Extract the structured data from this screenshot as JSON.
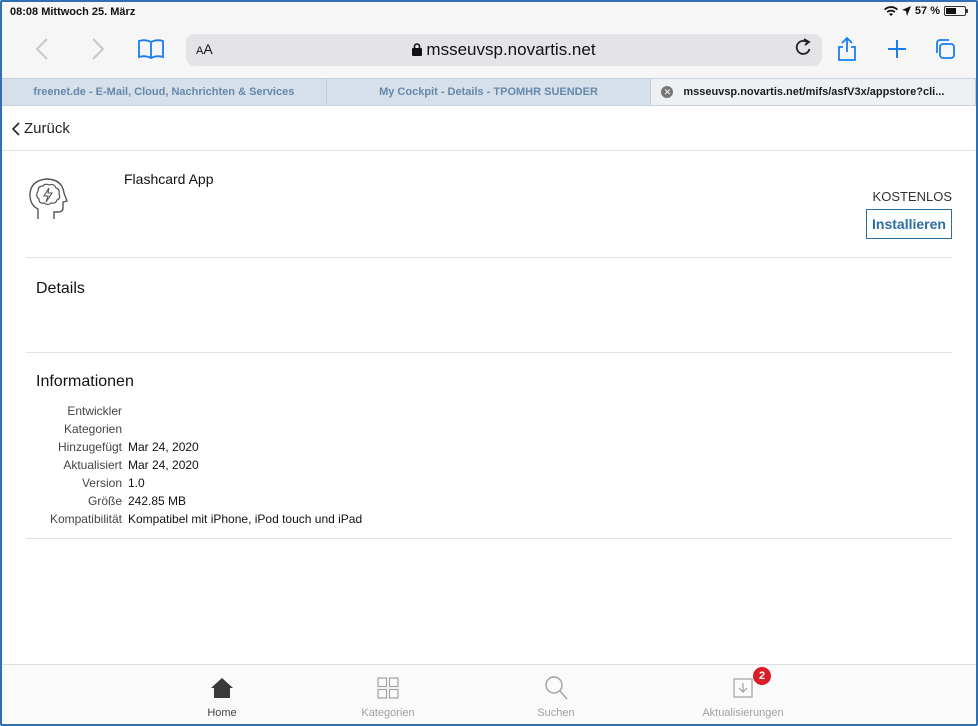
{
  "status_bar": {
    "time_date": "08:08  Mittwoch 25. März",
    "battery_text": "57 %",
    "battery_level": 0.57
  },
  "browser": {
    "reader_label_small": "A",
    "reader_label_large": "A",
    "url": "msseuvsp.novartis.net",
    "tabs": [
      {
        "title": "freenet.de - E-Mail, Cloud, Nachrichten & Services"
      },
      {
        "title": "My Cockpit - Details - TPOMHR SUENDER"
      },
      {
        "title": "msseuvsp.novartis.net/mifs/asfV3x/appstore?cli..."
      }
    ]
  },
  "nav": {
    "back_label": "Zurück"
  },
  "app": {
    "name": "Flashcard App",
    "price": "KOSTENLOS",
    "install_label": "Installieren"
  },
  "details": {
    "title": "Details"
  },
  "info": {
    "title": "Informationen",
    "rows": [
      {
        "label": "Entwickler",
        "value": ""
      },
      {
        "label": "Kategorien",
        "value": ""
      },
      {
        "label": "Hinzugefügt",
        "value": "Mar 24, 2020"
      },
      {
        "label": "Aktualisiert",
        "value": "Mar 24, 2020"
      },
      {
        "label": "Version",
        "value": "1.0"
      },
      {
        "label": "Größe",
        "value": "242.85 MB"
      },
      {
        "label": "Kompatibilität",
        "value": "Kompatibel mit iPhone, iPod touch und iPad"
      }
    ]
  },
  "tabbar": {
    "items": [
      {
        "label": "Home"
      },
      {
        "label": "Kategorien"
      },
      {
        "label": "Suchen"
      },
      {
        "label": "Aktualisierungen",
        "badge": "2"
      }
    ]
  },
  "colors": {
    "accent": "#1a7cf5",
    "install": "#2b6ea3",
    "badge": "#d91e27"
  }
}
